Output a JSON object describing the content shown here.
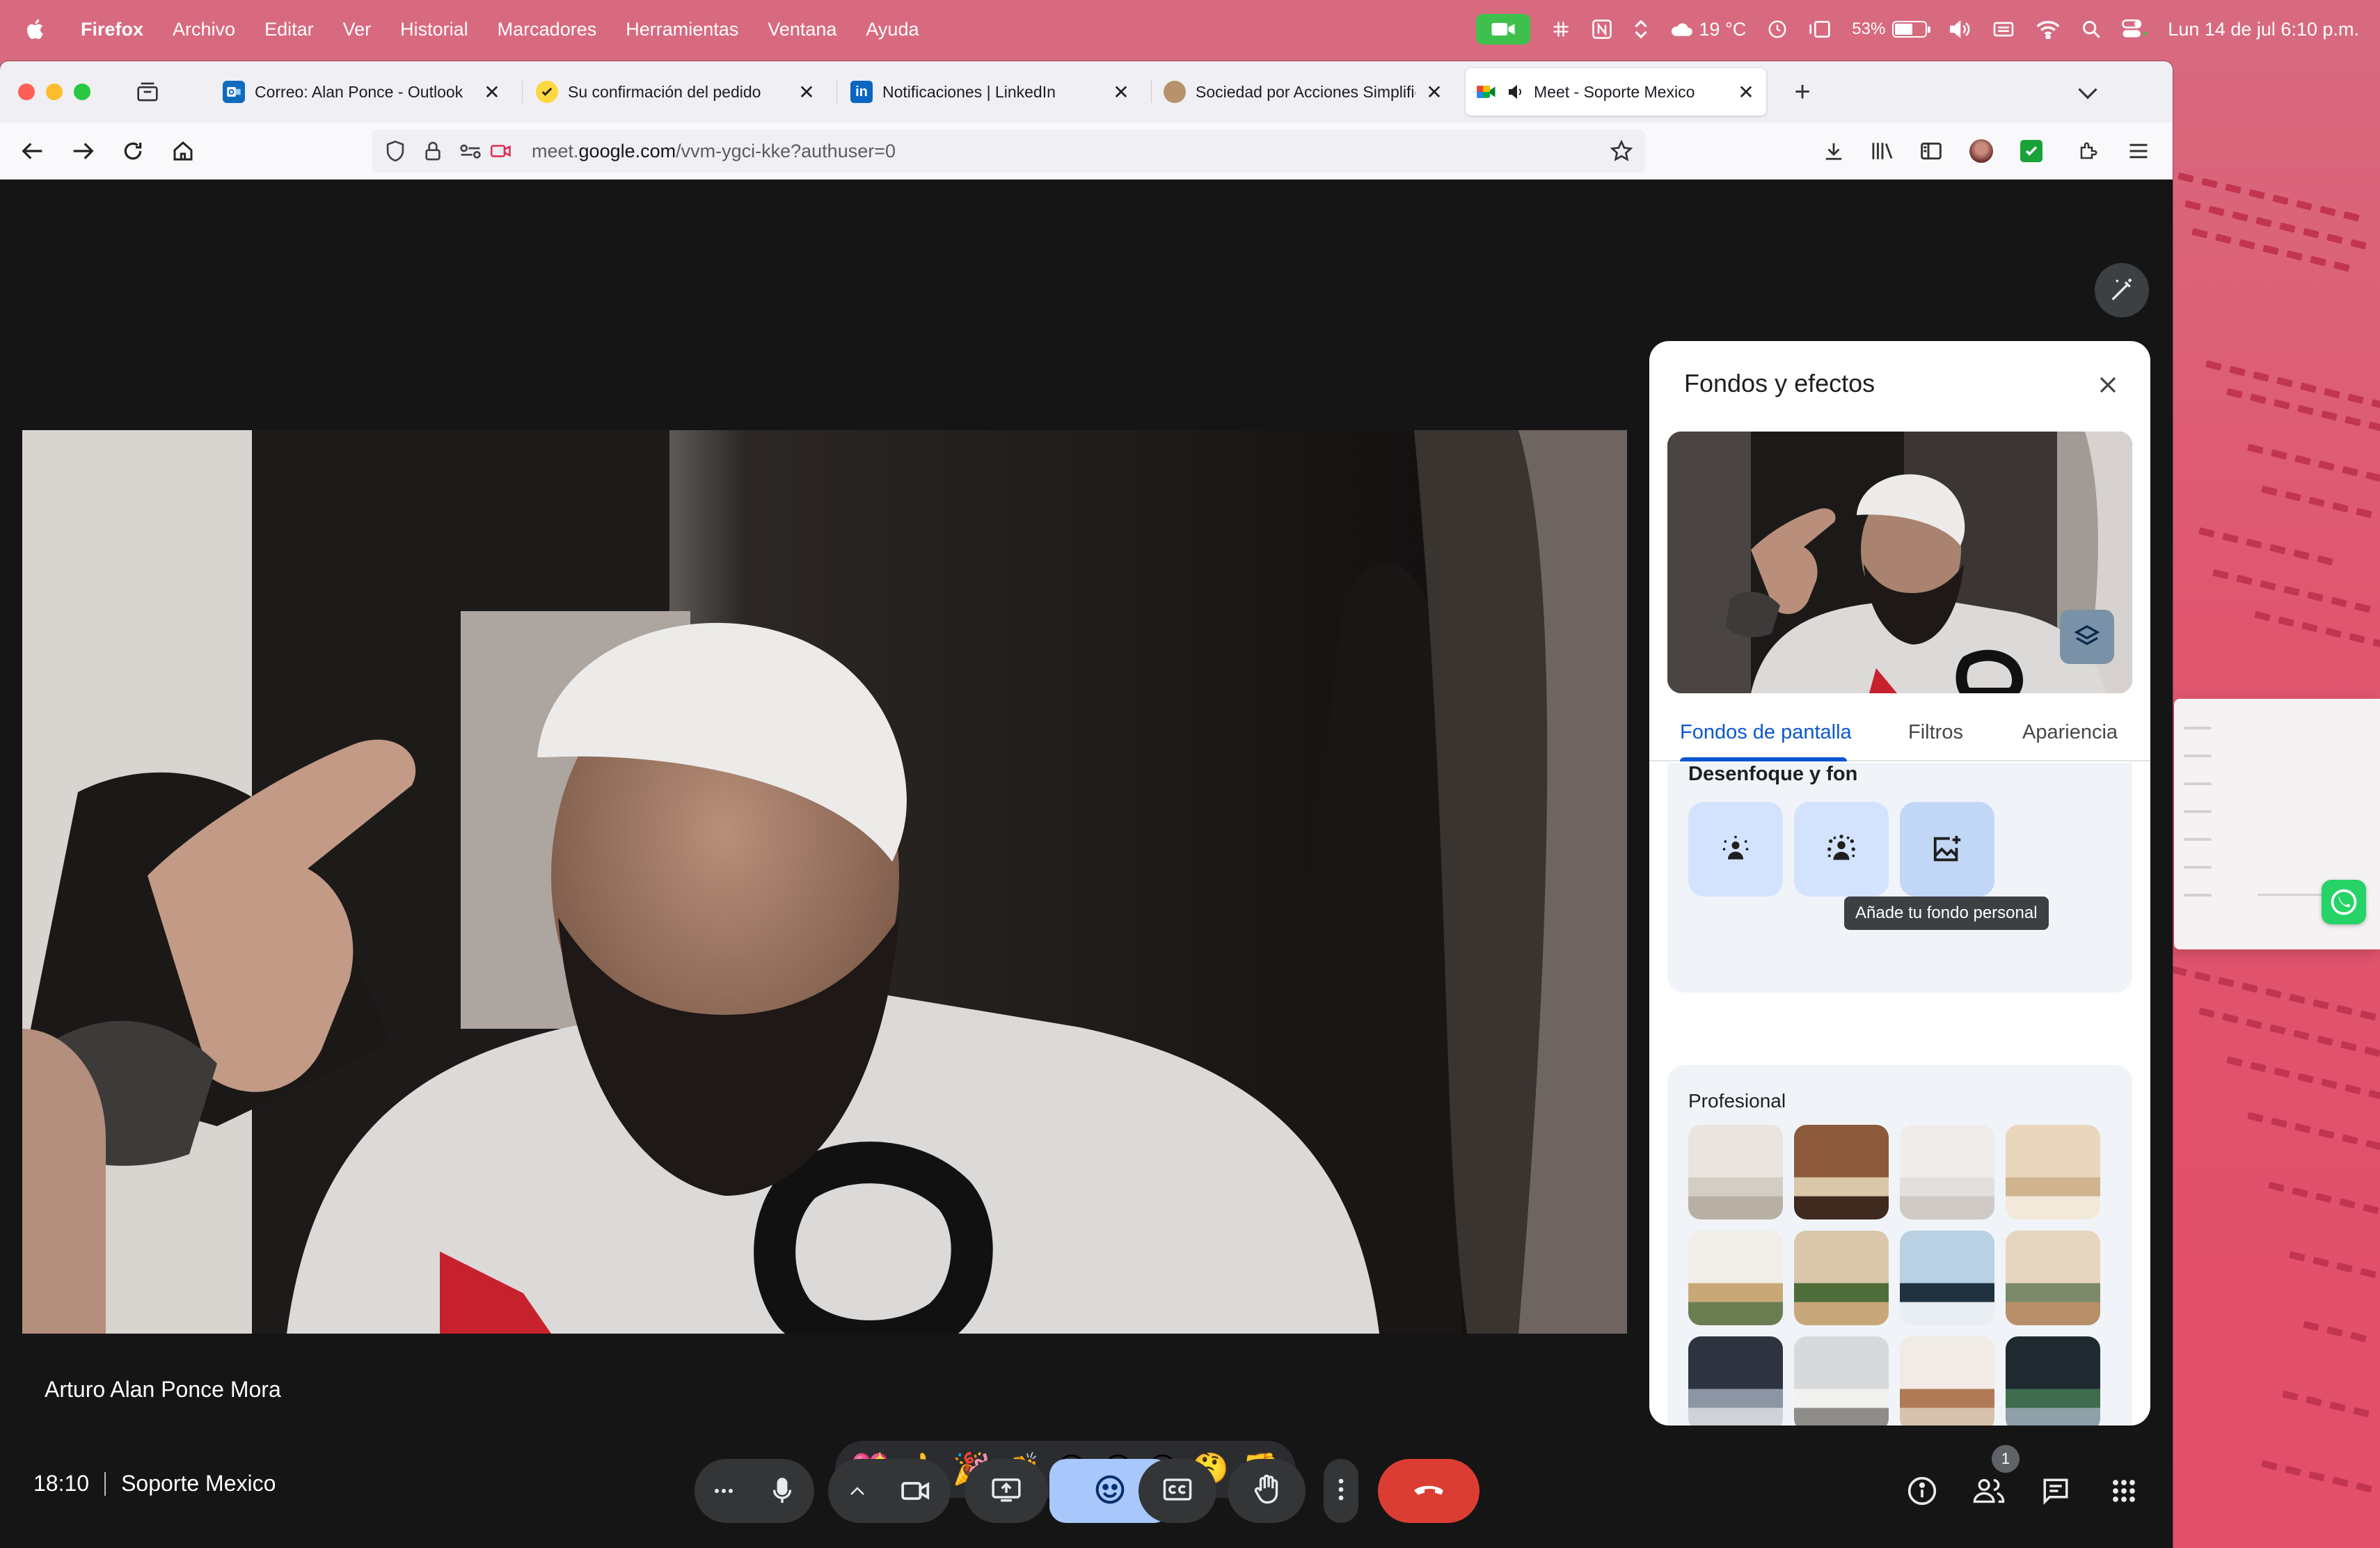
{
  "menubar": {
    "app_name": "Firefox",
    "items": [
      "Archivo",
      "Editar",
      "Ver",
      "Historial",
      "Marcadores",
      "Herramientas",
      "Ventana",
      "Ayuda"
    ],
    "weather": "19 °C",
    "battery_text": "53%",
    "battery_level": 0.53,
    "datetime": "Lun 14 de jul  6:10 p.m.",
    "icons": [
      "apple-logo",
      "meet-camera-active",
      "slack-icon",
      "notion-icon",
      "sort-icon",
      "weather-icon",
      "time-machine-icon",
      "stage-manager-icon",
      "battery-icon",
      "volume-icon",
      "keyboard-icon",
      "wifi-icon",
      "spotlight-icon",
      "control-center-icon"
    ]
  },
  "browser": {
    "tabs": [
      {
        "title": "Correo: Alan Ponce - Outlook",
        "icon": "outlook-icon",
        "active": false
      },
      {
        "title": "Su confirmación del pedido",
        "icon": "check-badge-icon",
        "active": false
      },
      {
        "title": "Notificaciones | LinkedIn",
        "icon": "linkedin-icon",
        "active": false
      },
      {
        "title": "Sociedad por Acciones Simplific",
        "icon": "circle-favicon",
        "active": false
      },
      {
        "title": "Meet - Soporte Mexico",
        "icon": "meet-icon",
        "active": true,
        "audio": true
      }
    ],
    "url_prefix": "meet.",
    "url_domain": "google.com",
    "url_path": "/vvm-ygci-kke?authuser=0"
  },
  "meet": {
    "participant_name": "Arturo Alan Ponce Mora",
    "time": "18:10",
    "meeting_name": "Soporte Mexico",
    "participants_badge": "1",
    "reactions": [
      "💖",
      "👍",
      "🎉",
      "👏",
      "😂",
      "😮",
      "😢",
      "🤔",
      "👎"
    ],
    "colors": {
      "end_call": "#dc3d32",
      "accent": "#0b57d0",
      "active_control": "#a8c7fa"
    }
  },
  "effects_panel": {
    "title": "Fondos y efectos",
    "tabs": [
      "Fondos de pantalla",
      "Filtros",
      "Apariencia"
    ],
    "active_tab": "Fondos de pantalla",
    "section_blur": "Desenfoque y fon",
    "tooltip": "Añade tu fondo personal",
    "section_pro": "Profesional"
  }
}
